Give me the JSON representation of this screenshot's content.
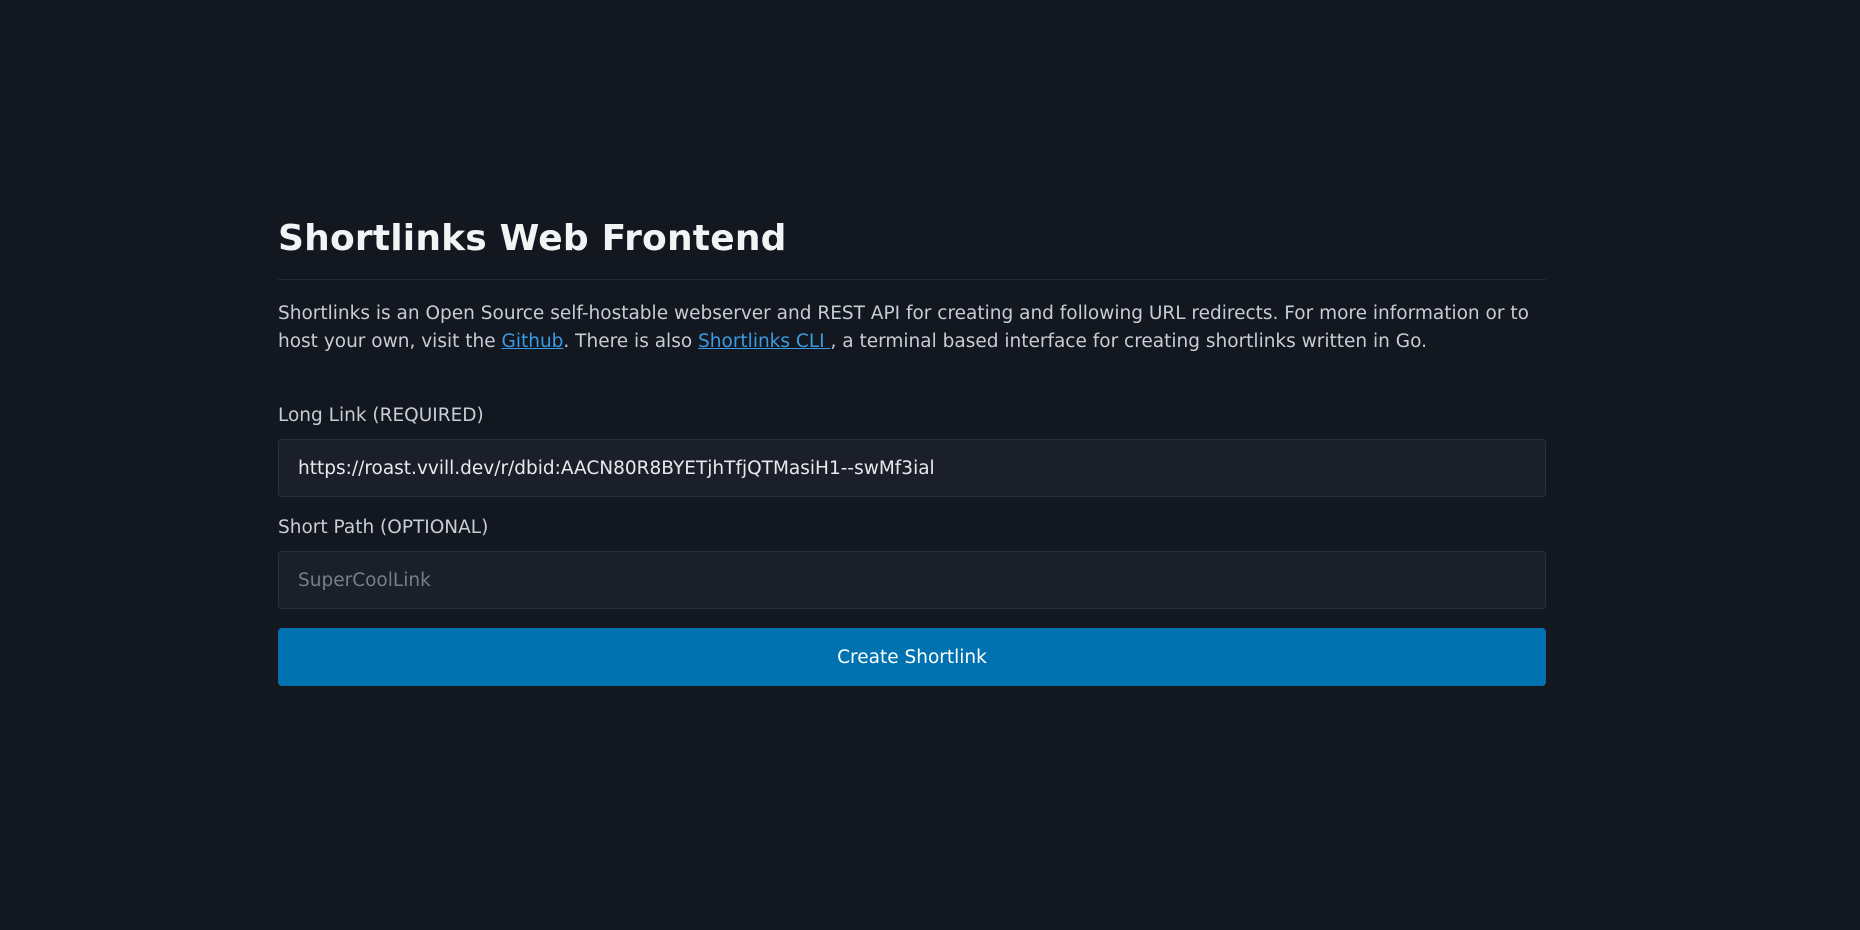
{
  "page": {
    "title": "Shortlinks Web Frontend"
  },
  "intro": {
    "text_1": "Shortlinks is an Open Source self-hostable webserver and REST API for creating and following URL redirects. For more information or to host your own, visit the ",
    "github_link": "Github",
    "text_2": ". There is also ",
    "cli_link": "Shortlinks CLI ",
    "text_3": ", a terminal based interface for creating shortlinks written in Go."
  },
  "form": {
    "long_link": {
      "label": "Long Link (REQUIRED)",
      "value": "https://roast.vvill.dev/r/dbid:AACN80R8BYETjhTfjQTMasiH1--swMf3ial"
    },
    "short_path": {
      "label": "Short Path (OPTIONAL)",
      "placeholder": "SuperCoolLink",
      "value": ""
    },
    "submit_label": "Create Shortlink"
  },
  "colors": {
    "background": "#13171f",
    "input_background": "#1b1f2a",
    "link": "#3a9be0",
    "button": "#0072b0"
  }
}
